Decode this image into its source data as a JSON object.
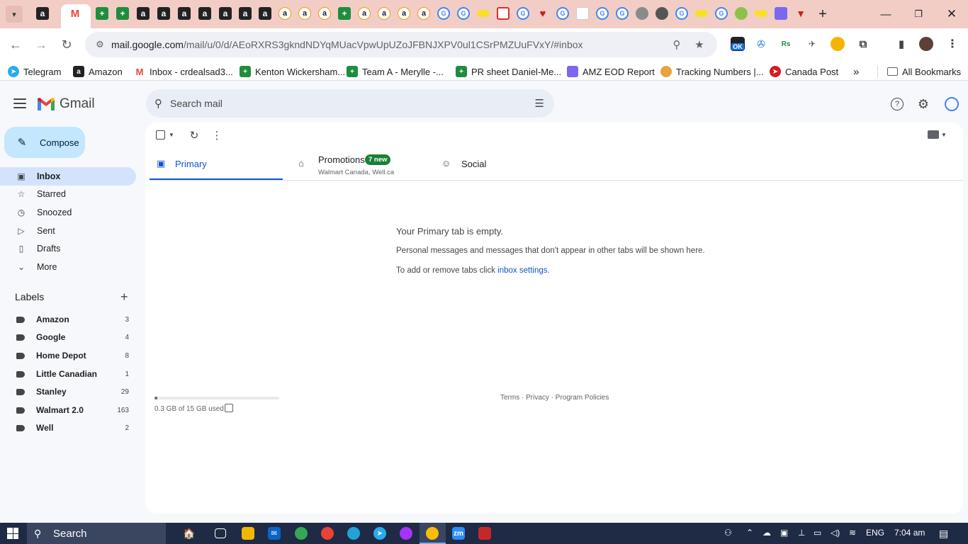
{
  "browser": {
    "url_host": "mail.google.com",
    "url_path": "/mail/u/0/d/AEoRXRS3gkndNDYqMUacVpwUpUZoJFBNJXPV0ul1CSrPMZUuFVxY/#inbox",
    "extension_badge": "OK",
    "bookmarks": [
      {
        "label": "Telegram",
        "icon": "telegram-icon",
        "color": "#2aabee"
      },
      {
        "label": "Amazon",
        "icon": "amazon-icon",
        "color": "#222222"
      },
      {
        "label": "Inbox - crdealsad3...",
        "icon": "gmail-icon",
        "color": "#ea4335"
      },
      {
        "label": "Kenton Wickersham...",
        "icon": "sheets-icon",
        "color": "#1e8e3e"
      },
      {
        "label": "Team A - Merylle -...",
        "icon": "sheets-icon",
        "color": "#1e8e3e"
      },
      {
        "label": "PR sheet Daniel-Me...",
        "icon": "sheets-icon",
        "color": "#1e8e3e"
      },
      {
        "label": "AMZ EOD Report",
        "icon": "clickup-icon",
        "color": "#7b68ee"
      },
      {
        "label": "Tracking Numbers |...",
        "icon": "taco-icon",
        "color": "#e8a33d"
      },
      {
        "label": "Canada Post",
        "icon": "canada-post-icon",
        "color": "#d71920"
      }
    ],
    "all_bookmarks_label": "All Bookmarks"
  },
  "gmail": {
    "logo_text": "Gmail",
    "search_placeholder": "Search mail",
    "compose_label": "Compose",
    "nav": [
      {
        "label": "Inbox",
        "icon": "inbox-icon",
        "active": true
      },
      {
        "label": "Starred",
        "icon": "star-icon"
      },
      {
        "label": "Snoozed",
        "icon": "clock-icon"
      },
      {
        "label": "Sent",
        "icon": "send-icon"
      },
      {
        "label": "Drafts",
        "icon": "draft-icon"
      },
      {
        "label": "More",
        "icon": "chevron-down-icon"
      }
    ],
    "labels_title": "Labels",
    "labels": [
      {
        "name": "Amazon",
        "count": "3"
      },
      {
        "name": "Google",
        "count": "4"
      },
      {
        "name": "Home Depot",
        "count": "8"
      },
      {
        "name": "Little Canadian",
        "count": "1"
      },
      {
        "name": "Stanley",
        "count": "29"
      },
      {
        "name": "Walmart 2.0",
        "count": "163"
      },
      {
        "name": "Well",
        "count": "2"
      }
    ],
    "tabs": {
      "primary": "Primary",
      "promotions": "Promotions",
      "promotions_badge": "7 new",
      "promotions_senders": "Walmart Canada, Well.ca",
      "social": "Social"
    },
    "empty": {
      "title": "Your Primary tab is empty.",
      "description": "Personal messages and messages that don't appear in other tabs will be shown here.",
      "settings_prefix": "To add or remove tabs click ",
      "settings_link": "inbox settings",
      "settings_suffix": "."
    },
    "storage": {
      "text": "0.3 GB of 15 GB used",
      "fraction": 0.02
    },
    "footer": "Terms · Privacy · Program Policies",
    "accent": "#0b57d0",
    "compose_color": "#c2e7ff"
  },
  "taskbar": {
    "search_label": "Search",
    "language": "ENG",
    "time": "7:04 am"
  }
}
